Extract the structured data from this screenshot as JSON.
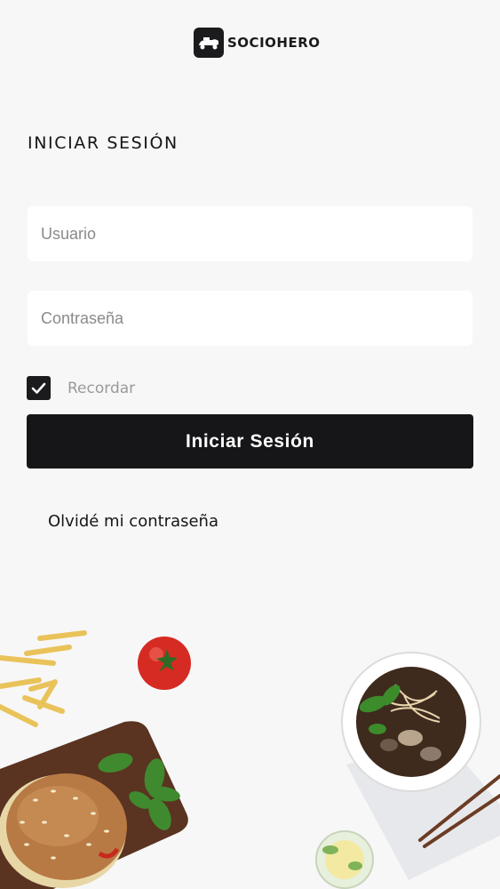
{
  "brand": {
    "name": "SOCIOHERO",
    "icon": "moped-icon"
  },
  "login": {
    "title": "INICIAR SESIÓN",
    "username_placeholder": "Usuario",
    "password_placeholder": "Contraseña",
    "remember_label": "Recordar",
    "remember_checked": true,
    "submit_label": "Iniciar Sesión",
    "forgot_label": "Olvidé mi contraseña"
  },
  "colors": {
    "background": "#f7f7f8",
    "primary": "#161618",
    "button_text": "#ffffff",
    "placeholder": "#8a8a8a"
  }
}
